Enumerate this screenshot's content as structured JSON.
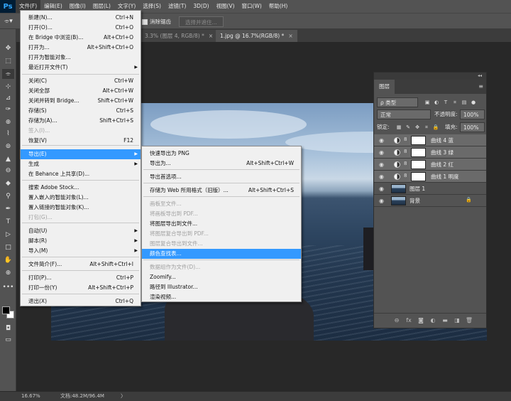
{
  "app": {
    "logo": "Ps"
  },
  "menubar": {
    "items": [
      "文件(F)",
      "编辑(E)",
      "图像(I)",
      "图层(L)",
      "文字(Y)",
      "选择(S)",
      "滤镜(T)",
      "3D(D)",
      "视图(V)",
      "窗口(W)",
      "帮助(H)"
    ]
  },
  "options_bar": {
    "checkbox_label": "消除锯齿",
    "select_and_mask": "选择并遮住..."
  },
  "tabs": [
    {
      "label": "3.3% (图层 4, RGB/8) *",
      "active": false
    },
    {
      "label": "1.jpg @ 16.7%(RGB/8) *",
      "active": true
    }
  ],
  "tab_close_glyph": "×",
  "file_menu": {
    "items": [
      {
        "label": "新建(N)...",
        "shortcut": "Ctrl+N"
      },
      {
        "label": "打开(O)...",
        "shortcut": "Ctrl+O"
      },
      {
        "label": "在 Bridge 中浏览(B)...",
        "shortcut": "Alt+Ctrl+O"
      },
      {
        "label": "打开为...",
        "shortcut": "Alt+Shift+Ctrl+O"
      },
      {
        "label": "打开为智能对象..."
      },
      {
        "label": "最近打开文件(T)",
        "submenu": true
      },
      {
        "label": "关闭(C)",
        "shortcut": "Ctrl+W"
      },
      {
        "label": "关闭全部",
        "shortcut": "Alt+Ctrl+W"
      },
      {
        "label": "关闭并转到 Bridge...",
        "shortcut": "Shift+Ctrl+W"
      },
      {
        "label": "存储(S)",
        "shortcut": "Ctrl+S"
      },
      {
        "label": "存储为(A)...",
        "shortcut": "Shift+Ctrl+S"
      },
      {
        "label": "签入(I)...",
        "disabled": true
      },
      {
        "label": "恢复(V)",
        "shortcut": "F12"
      },
      {
        "label": "导出(E)",
        "submenu": true,
        "highlight": true
      },
      {
        "label": "生成",
        "submenu": true
      },
      {
        "label": "在 Behance 上共享(D)..."
      },
      {
        "label": "搜索 Adobe Stock..."
      },
      {
        "label": "置入嵌入的智能对象(L)..."
      },
      {
        "label": "置入链接的智能对象(K)..."
      },
      {
        "label": "打包(G)...",
        "disabled": true
      },
      {
        "label": "自动(U)",
        "submenu": true
      },
      {
        "label": "脚本(R)",
        "submenu": true
      },
      {
        "label": "导入(M)",
        "submenu": true
      },
      {
        "label": "文件简介(F)...",
        "shortcut": "Alt+Shift+Ctrl+I"
      },
      {
        "label": "打印(P)...",
        "shortcut": "Ctrl+P"
      },
      {
        "label": "打印一份(Y)",
        "shortcut": "Alt+Shift+Ctrl+P"
      },
      {
        "label": "退出(X)",
        "shortcut": "Ctrl+Q"
      }
    ]
  },
  "export_menu": {
    "items": [
      {
        "label": "快速导出为 PNG"
      },
      {
        "label": "导出为...",
        "shortcut": "Alt+Shift+Ctrl+W"
      },
      {
        "label": "导出首选项..."
      },
      {
        "label": "存储为 Web 所用格式（旧版）...",
        "shortcut": "Alt+Shift+Ctrl+S"
      },
      {
        "label": "画板至文件...",
        "disabled": true
      },
      {
        "label": "将画板导出到 PDF...",
        "disabled": true
      },
      {
        "label": "将图层导出到文件..."
      },
      {
        "label": "将图层复合导出到 PDF...",
        "disabled": true
      },
      {
        "label": "图层复合导出到文件...",
        "disabled": true
      },
      {
        "label": "颜色查找表...",
        "highlight": true
      },
      {
        "label": "数据组作为文件(D)...",
        "disabled": true
      },
      {
        "label": "Zoomify..."
      },
      {
        "label": "路径到 Illustrator..."
      },
      {
        "label": "渲染视频..."
      }
    ]
  },
  "submenu_arrow": "▶",
  "layers_panel": {
    "tab_label": "图层",
    "menu_glyph": "≡",
    "collapse_glyph": "◂◂",
    "filter_kind": "ρ 类型",
    "blend_mode": "正常",
    "opacity_label": "不透明度:",
    "opacity_value": "100%",
    "lock_label": "锁定:",
    "fill_label": "填充:",
    "fill_value": "100%",
    "filter_icons": [
      "▣",
      "◐",
      "T",
      "⌗",
      "▤",
      "●"
    ],
    "lock_icons": [
      "▦",
      "✎",
      "✥",
      "⌗",
      "🔒"
    ],
    "layers": [
      {
        "name": "曲线 4 蓝",
        "kind": "adjustment"
      },
      {
        "name": "曲线 3 绿",
        "kind": "adjustment"
      },
      {
        "name": "曲线 2 红",
        "kind": "adjustment"
      },
      {
        "name": "曲线 1 明度",
        "kind": "adjustment"
      },
      {
        "name": "图层 1",
        "kind": "pixel"
      },
      {
        "name": "背景",
        "kind": "pixel",
        "locked": true
      }
    ],
    "eye_glyph": "◉",
    "chain_glyph": "8",
    "lock_glyph": "🔒",
    "footer_icons": [
      "⊖",
      "fx",
      "◙",
      "◐",
      "▬",
      "◨",
      "🗑"
    ]
  },
  "status": {
    "zoom": "16.67%",
    "doc_size": "文档:48.2M/96.4M",
    "arrow": "〉"
  },
  "toolbar": {
    "tools": [
      "✥",
      "⬚",
      "⌯",
      "⊹",
      "⊿",
      "✑",
      "⊕",
      "⌇",
      "⊚",
      "▲",
      "⊖",
      "◆",
      "⚲",
      "✒",
      "T",
      "▷",
      "□",
      "✋",
      "⊕",
      "•••"
    ],
    "selected_index": 2
  }
}
